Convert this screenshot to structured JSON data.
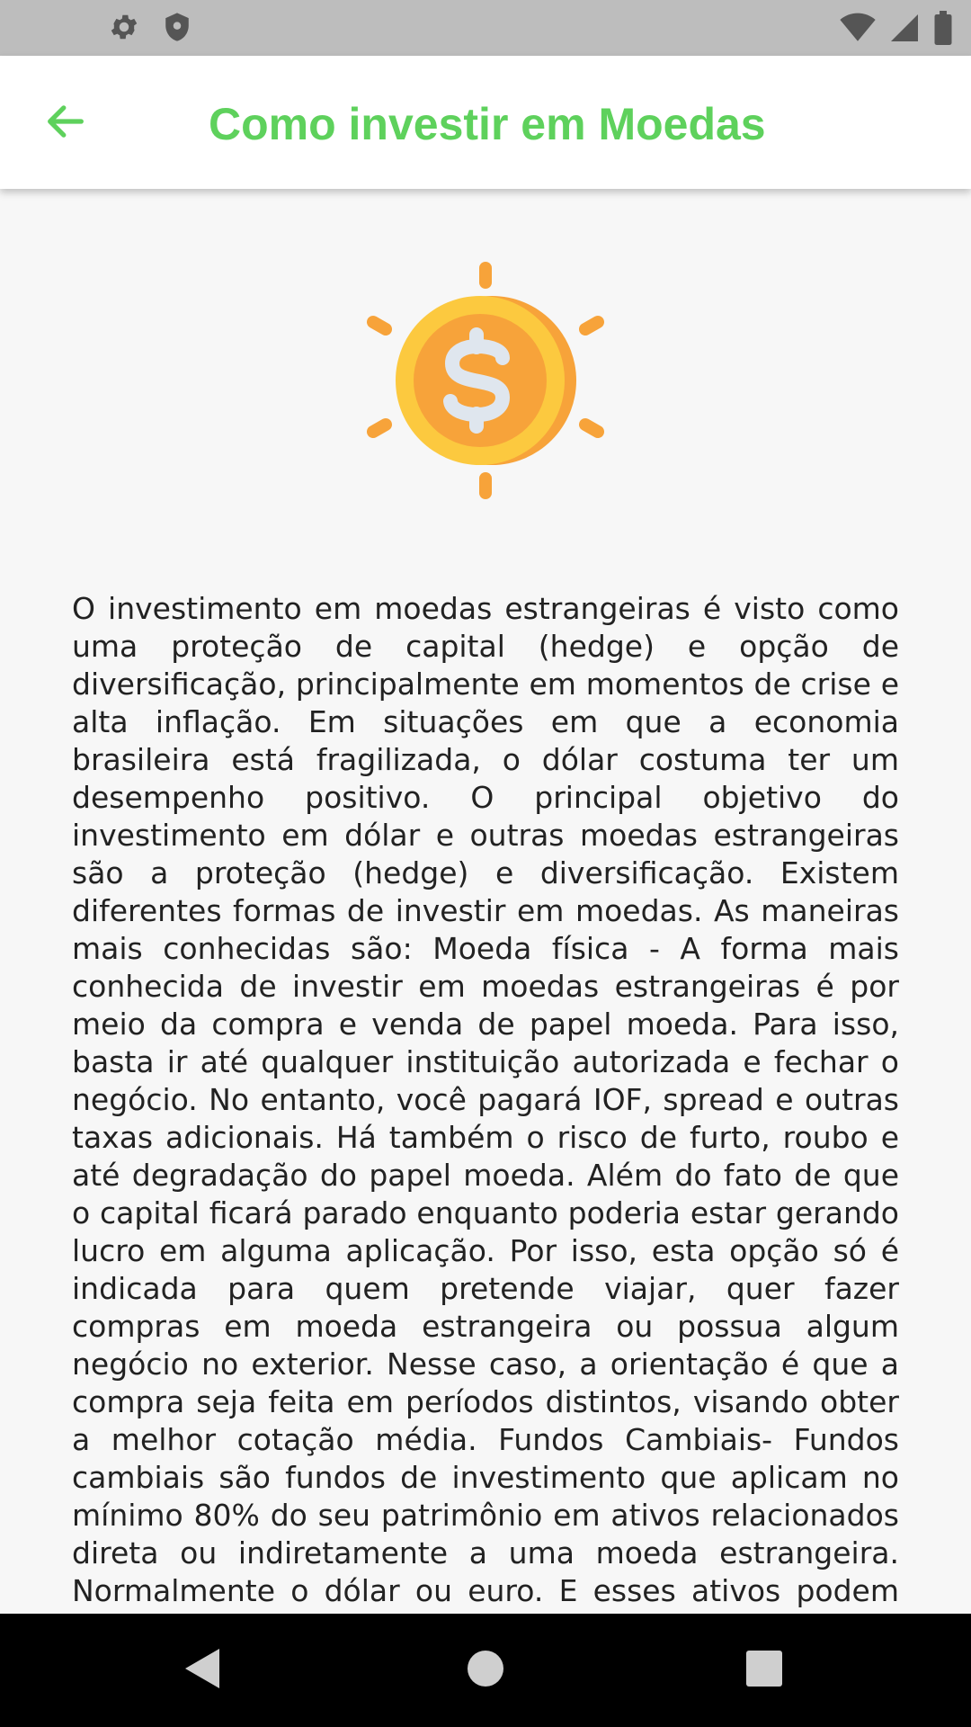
{
  "status_bar": {
    "left_icons": [
      "gear-icon",
      "shield-icon"
    ],
    "right_icons": [
      "wifi-icon",
      "signal-icon",
      "battery-icon"
    ]
  },
  "app_bar": {
    "title": "Como investir em Moedas",
    "back_icon": "arrow-left-icon",
    "accent_color": "#5ed15c"
  },
  "illustration": {
    "icon": "coin-dollar-icon",
    "colors": {
      "outer": "#f7a33a",
      "ring": "#fcc93f",
      "symbol": "#dfe6ee"
    }
  },
  "article": {
    "text": "O investimento em moedas estrangeiras é visto como uma proteção de capital (hedge) e opção de diversificação, principalmente em momentos de crise e alta inflação. Em situações em que a economia brasileira está fragilizada, o dólar costuma ter um desempenho positivo. O principal objetivo do investimento em dólar e outras moedas estrangeiras são a proteção (hedge) e diversificação. Existem diferentes formas de investir em moedas. As maneiras mais conhecidas são: Moeda física - A forma mais conhecida de investir em moedas estrangeiras é por meio da compra e venda de papel moeda. Para isso, basta ir até qualquer instituição autorizada e fechar o negócio. No entanto, você pagará IOF, spread e outras taxas adicionais. Há também o risco de furto, roubo e até degradação do papel moeda. Além do fato de que o capital ficará parado enquanto poderia estar gerando lucro em alguma aplicação. Por isso, esta opção só é indicada para quem pretende viajar, quer fazer compras em moeda estrangeira ou possua algum negócio no exterior. Nesse caso, a orientação é que a compra seja feita em períodos distintos, visando obter a melhor cotação média. Fundos Cambiais- Fundos cambiais são fundos de investimento que aplicam no mínimo 80% do seu patrimônio em ativos relacionados direta ou indiretamente a uma moeda estrangeira. Normalmente o dólar ou euro. E esses ativos podem ser de qualquer"
  },
  "nav_bar": {
    "buttons": [
      "back-triangle-icon",
      "home-circle-icon",
      "recents-square-icon"
    ]
  }
}
